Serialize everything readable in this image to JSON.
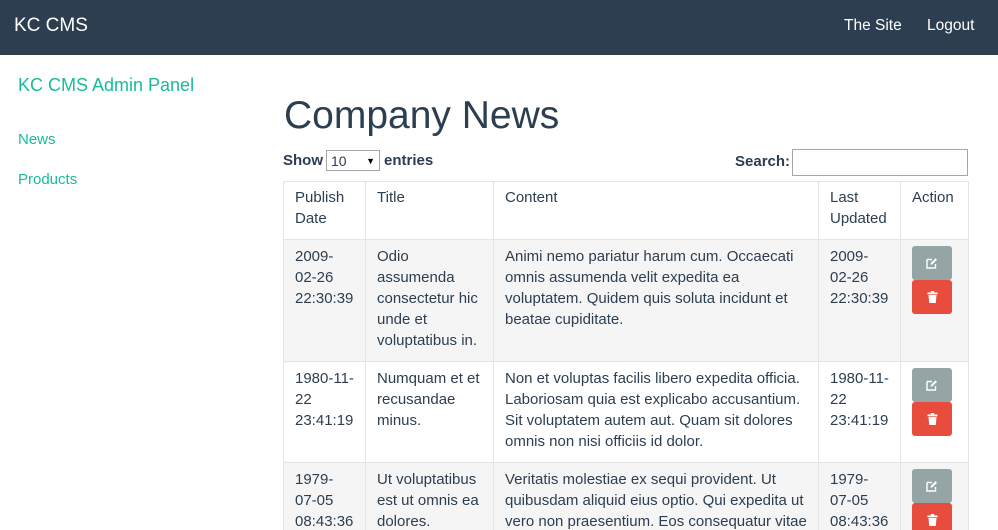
{
  "navbar": {
    "brand": "KC CMS",
    "links": [
      "The Site",
      "Logout"
    ],
    "background": "#2c3e50"
  },
  "sidebar": {
    "title": "KC CMS Admin Panel",
    "items": [
      {
        "label": "News"
      },
      {
        "label": "Products"
      }
    ],
    "accent": "#18bc9c"
  },
  "main": {
    "title": "Company News",
    "length": {
      "show": "Show",
      "selected": "10",
      "entries": "entries"
    },
    "search": {
      "label": "Search:",
      "value": ""
    },
    "table": {
      "headers": [
        "Publish Date",
        "Title",
        "Content",
        "Last Updated",
        "Action"
      ],
      "rows": [
        {
          "publish_date": "2009-02-26 22:30:39",
          "title": "Odio assumenda consectetur hic unde et voluptatibus in.",
          "content": "Animi nemo pariatur harum cum. Occaecati omnis assumenda velit expedita ea voluptatem. Quidem quis soluta incidunt et beatae cupiditate.",
          "last_updated": "2009-02-26 22:30:39"
        },
        {
          "publish_date": "1980-11-22 23:41:19",
          "title": "Numquam et et recusandae minus.",
          "content": "Non et voluptas facilis libero expedita officia. Laboriosam quia est explicabo accusantium. Sit voluptatem autem aut. Quam sit dolores omnis non nisi officiis id dolor.",
          "last_updated": "1980-11-22 23:41:19"
        },
        {
          "publish_date": "1979-07-05 08:43:36",
          "title": "Ut voluptatibus est ut omnis ea dolores.",
          "content": "Veritatis molestiae ex sequi provident. Ut quibusdam aliquid eius optio. Qui expedita ut vero non praesentium. Eos consequatur vitae",
          "last_updated": "1979-07-05 08:43:36"
        }
      ],
      "actions": {
        "edit_icon": "edit-icon",
        "delete_icon": "trash-icon",
        "edit_color": "#95a5a6",
        "delete_color": "#e74c3c"
      }
    }
  }
}
